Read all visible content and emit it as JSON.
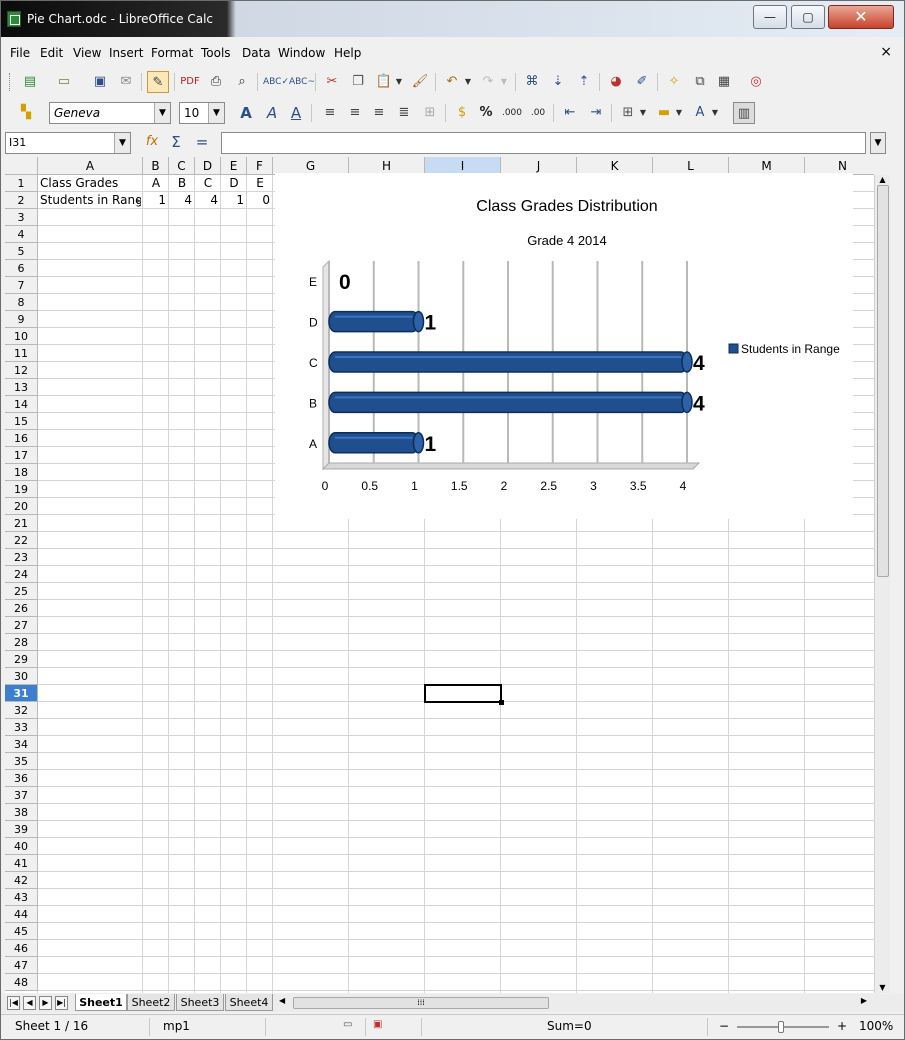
{
  "window": {
    "title": "Pie Chart.odc - LibreOffice Calc",
    "minimize_label": "—",
    "maximize_label": "▢",
    "close_label": "✕"
  },
  "menu": {
    "items": [
      "File",
      "Edit",
      "View",
      "Insert",
      "Format",
      "Tools",
      "Data",
      "Window",
      "Help"
    ],
    "doc_close": "×"
  },
  "toolbar2": {
    "font_name": "Geneva",
    "font_size": "10"
  },
  "formula_bar": {
    "name_box": "I31",
    "content": ""
  },
  "columns": [
    "A",
    "B",
    "C",
    "D",
    "E",
    "F",
    "G",
    "H",
    "I",
    "J",
    "K",
    "L",
    "M",
    "N"
  ],
  "selected_column": "I",
  "rows_visible": 48,
  "selected_row": 31,
  "cells": {
    "A1": "Class Grades",
    "B1": "A",
    "C1": "B",
    "D1": "C",
    "E1": "D",
    "F1": "E",
    "A2": "Students in Range",
    "B2": "1",
    "C2": "4",
    "D2": "4",
    "E2": "1",
    "F2": "0"
  },
  "chart_data": {
    "type": "bar",
    "orientation": "horizontal",
    "title": "Class Grades Distribution",
    "subtitle": "Grade 4 2014",
    "categories": [
      "A",
      "B",
      "C",
      "D",
      "E"
    ],
    "series": [
      {
        "name": "Students in Range",
        "values": [
          1,
          4,
          4,
          1,
          0
        ],
        "color": "#1f4f8f"
      }
    ],
    "data_labels": [
      "1",
      "4",
      "4",
      "1",
      "0"
    ],
    "x_ticks": [
      "0",
      "0.5",
      "1",
      "1.5",
      "2",
      "2.5",
      "3",
      "3.5",
      "4"
    ],
    "xlim": [
      0,
      4
    ],
    "grid": true,
    "legend": "right",
    "three_d": true
  },
  "sheet_tabs": [
    "Sheet1",
    "Sheet2",
    "Sheet3",
    "Sheet4"
  ],
  "active_sheet": "Sheet1",
  "status": {
    "sheet": "Sheet 1 / 16",
    "style": "mp1",
    "sum": "Sum=0",
    "zoom": "100%"
  },
  "colors": {
    "bar": "#1f4f8f",
    "selection_header": "#3c7fd0",
    "grid_line": "#d4d4d4"
  }
}
